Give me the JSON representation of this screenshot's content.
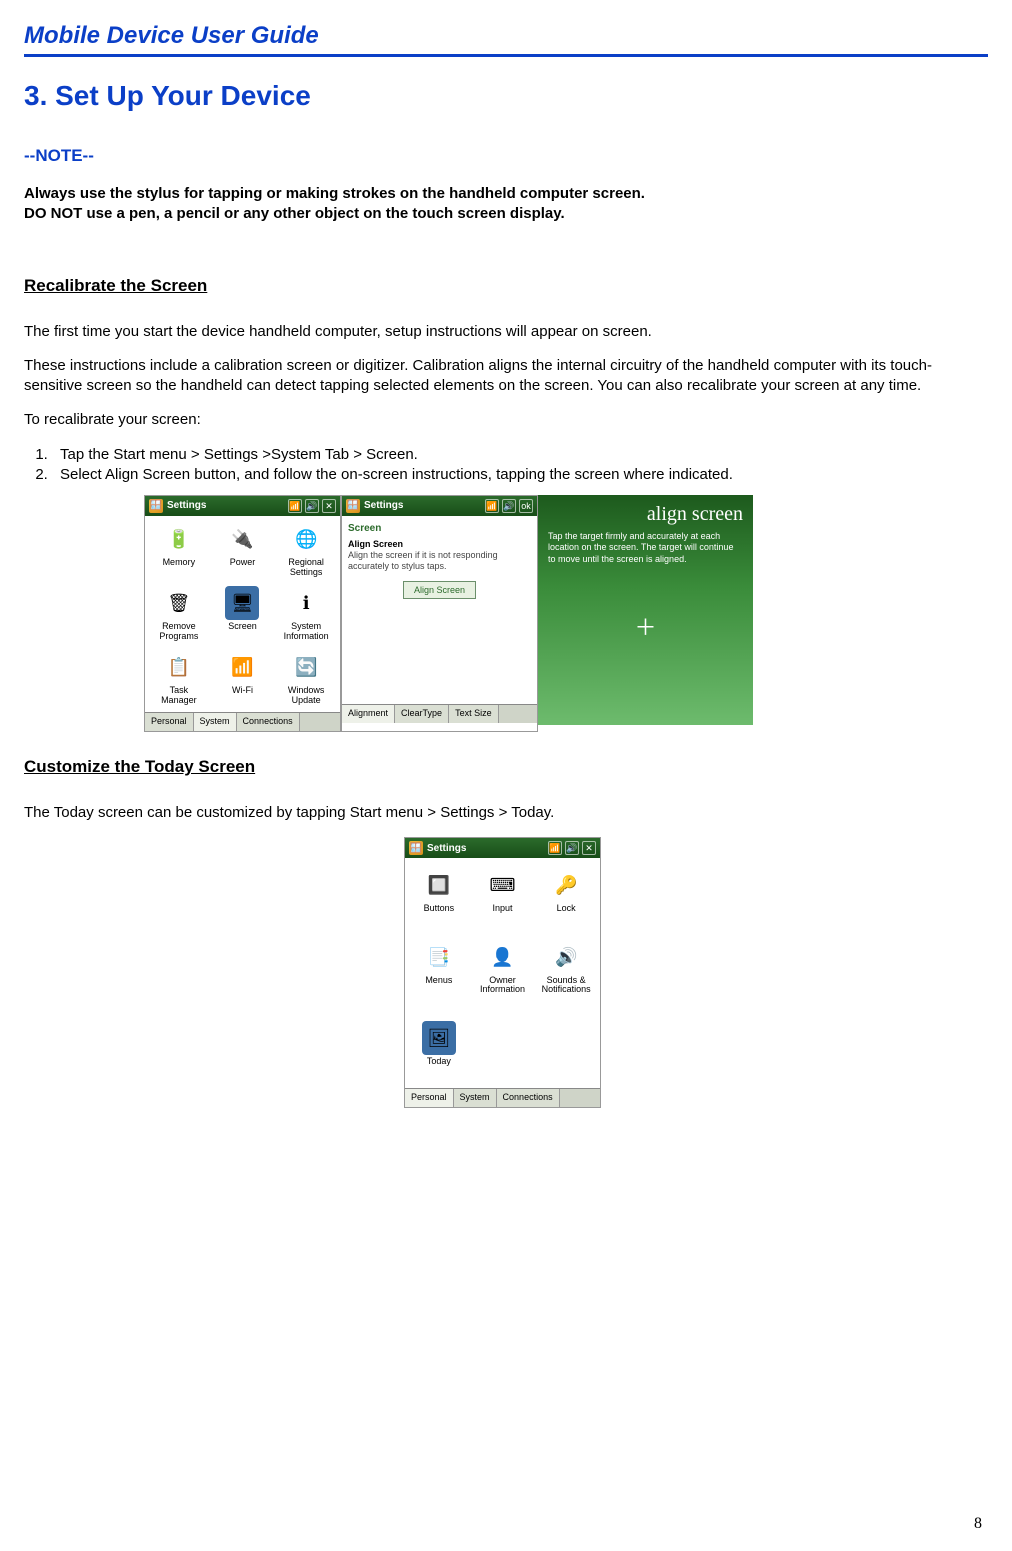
{
  "header": {
    "title": "Mobile Device User Guide"
  },
  "chapter": {
    "title": "3.  Set Up Your Device"
  },
  "note": {
    "label": "--NOTE--",
    "line1": "Always use the stylus for tapping or making strokes on the handheld computer screen.",
    "line2": "DO NOT use a pen, a pencil or any other object on the touch screen display."
  },
  "section_recal": {
    "heading": "Recalibrate the Screen",
    "para1": "The first time you start the device handheld computer, setup instructions will appear on screen.",
    "para2": "These instructions include a calibration screen or digitizer. Calibration aligns the internal circuitry of the handheld computer with its touch-sensitive screen so the handheld can detect tapping selected elements on the screen. You can also recalibrate your screen at any time.",
    "steps_label": "To recalibrate your screen:",
    "step1": "Tap the Start menu > Settings >System Tab > Screen.",
    "step2": "Select Align Screen button, and follow the on-screen instructions, tapping the screen where indicated."
  },
  "screens": {
    "settings_title": "Settings",
    "system_icons": [
      {
        "name": "memory",
        "label": "Memory",
        "glyph": "🔋"
      },
      {
        "name": "power",
        "label": "Power",
        "glyph": "🔌"
      },
      {
        "name": "regional",
        "label": "Regional\nSettings",
        "glyph": "🌐"
      },
      {
        "name": "remove",
        "label": "Remove\nPrograms",
        "glyph": "🗑"
      },
      {
        "name": "screen",
        "label": "Screen",
        "glyph": "🖥",
        "selected": true
      },
      {
        "name": "sysinfo",
        "label": "System\nInformation",
        "glyph": "ℹ"
      },
      {
        "name": "task",
        "label": "Task\nManager",
        "glyph": "📋"
      },
      {
        "name": "wifi",
        "label": "Wi-Fi",
        "glyph": "📶"
      },
      {
        "name": "winup",
        "label": "Windows\nUpdate",
        "glyph": "🔄"
      }
    ],
    "tabs_system": [
      "Personal",
      "System",
      "Connections"
    ],
    "tabs_system_active": 1,
    "screen_panel": {
      "heading": "Screen",
      "sub": "Align Screen",
      "desc": "Align the screen if it is not responding accurately to stylus taps.",
      "button": "Align Screen",
      "tabs": [
        "Alignment",
        "ClearType",
        "Text Size"
      ],
      "tabs_active": 0
    },
    "align": {
      "title": "align screen",
      "text": "Tap the target firmly and accurately at each location on the screen. The target will continue to move until the screen is aligned."
    },
    "personal_icons": [
      {
        "name": "buttons",
        "label": "Buttons",
        "glyph": "🔲"
      },
      {
        "name": "input",
        "label": "Input",
        "glyph": "⌨"
      },
      {
        "name": "lock",
        "label": "Lock",
        "glyph": "🔑"
      },
      {
        "name": "menus",
        "label": "Menus",
        "glyph": "📑"
      },
      {
        "name": "owner",
        "label": "Owner\nInformation",
        "glyph": "👤"
      },
      {
        "name": "sounds",
        "label": "Sounds &\nNotifications",
        "glyph": "🔊"
      },
      {
        "name": "today",
        "label": "Today",
        "glyph": "🖼",
        "selected": true
      }
    ],
    "tabs_personal": [
      "Personal",
      "System",
      "Connections"
    ],
    "tabs_personal_active": 0
  },
  "section_today": {
    "heading": "Customize the Today Screen",
    "para": "The Today screen can be customized by tapping Start menu > Settings > Today."
  },
  "page_number": "8"
}
